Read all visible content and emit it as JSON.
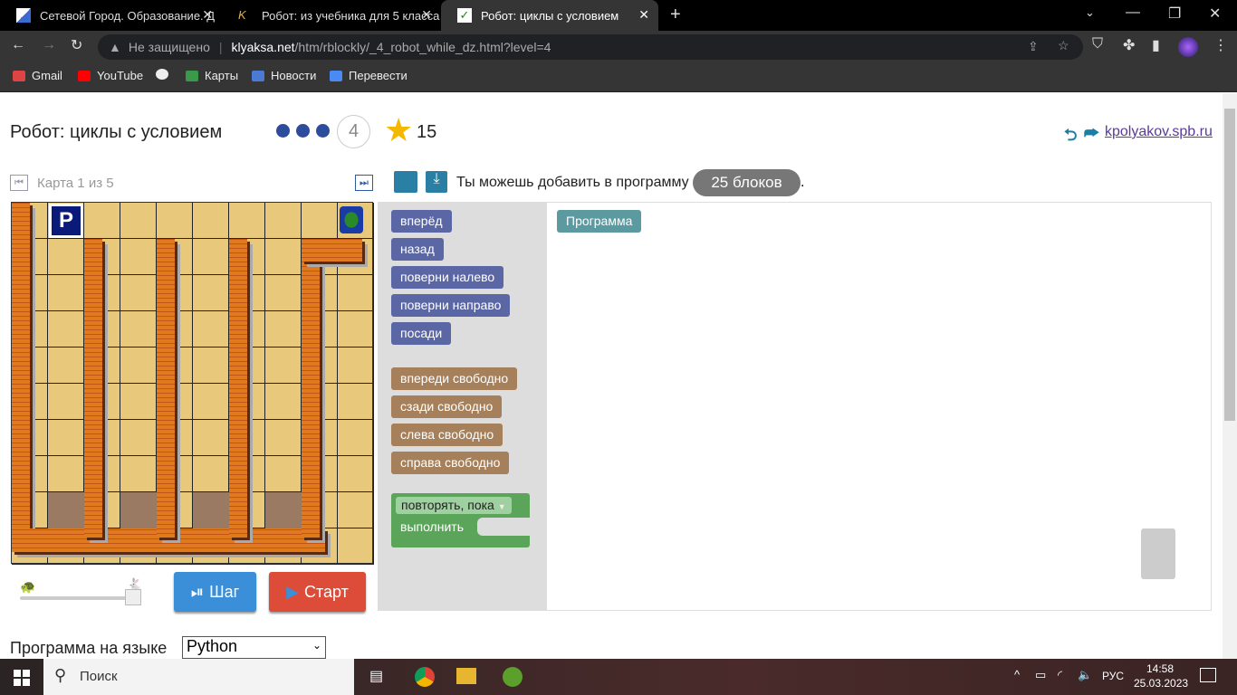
{
  "browser": {
    "tabs": [
      {
        "title": "Сетевой Город. Образование. Д"
      },
      {
        "title": "Робот: из учебника для 5 класса"
      },
      {
        "title": "Робот: циклы с условием",
        "active": true
      }
    ],
    "url_warning": "Не защищено",
    "url_domain": "klyaksa.net",
    "url_path": "/htm/rblockly/_4_robot_while_dz.html?level=4",
    "bookmarks": [
      "Gmail",
      "YouTube",
      "Карты",
      "Новости",
      "Перевести"
    ]
  },
  "page": {
    "title": "Робот: циклы с условием",
    "level": "4",
    "levels_done": 3,
    "stars": "15",
    "site_link": "kpolyakov.spb.ru",
    "map_label": "Карта 1 из 5",
    "blocks_msg": "Ты можешь добавить в программу",
    "blocks_count": "25 блоков",
    "blocks_end": ".",
    "toolbox": {
      "actions": [
        "вперёд",
        "назад",
        "поверни налево",
        "поверни направо",
        "посади"
      ],
      "conditions": [
        "впереди свободно",
        "сзади свободно",
        "слева свободно",
        "справа свободно"
      ],
      "loop_label": "повторять, пока",
      "loop_do": "выполнить"
    },
    "program_block": "Программа",
    "step_button": "Шаг",
    "start_button": "Старт",
    "lang_label": "Программа на языке",
    "lang_value": "Python",
    "colors": {
      "action": "#5b67a5",
      "condition": "#a5805b",
      "loop": "#5ba55b",
      "program": "#5b9aa0",
      "step": "#3a8fd8",
      "start": "#dd4b39"
    }
  },
  "taskbar": {
    "search": "Поиск",
    "lang": "РУС",
    "time": "14:58",
    "date": "25.03.2023"
  }
}
